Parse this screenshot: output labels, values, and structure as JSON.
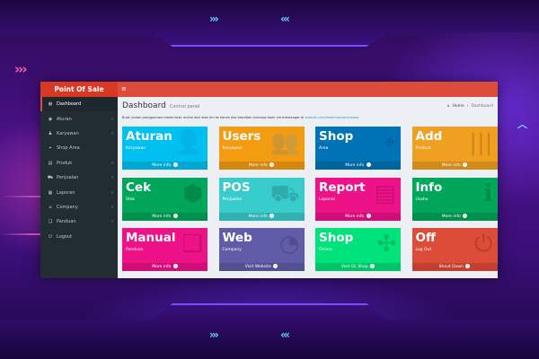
{
  "window": {
    "logo": "Point Of Sale",
    "menu_icon": "≡"
  },
  "sidebar": {
    "items": [
      {
        "label": "Dashboard",
        "icon": "◍",
        "arrow": ""
      },
      {
        "label": "Aturan",
        "icon": "◉",
        "arrow": "‹"
      },
      {
        "label": "Karyawan",
        "icon": "♟",
        "arrow": "‹"
      },
      {
        "label": "Shop Area",
        "icon": "⌖",
        "arrow": ""
      },
      {
        "label": "Produk",
        "icon": "▤",
        "arrow": "‹"
      },
      {
        "label": "Penjualan",
        "icon": "⛟",
        "arrow": "‹"
      },
      {
        "label": "Laporan",
        "icon": "▦",
        "arrow": "‹"
      },
      {
        "label": "Company",
        "icon": "⌂",
        "arrow": "‹"
      },
      {
        "label": "Panduan",
        "icon": "❏",
        "arrow": "‹"
      },
      {
        "label": "Logout",
        "icon": "⏻",
        "arrow": ""
      }
    ]
  },
  "header": {
    "title": "Dashboard",
    "subtitle": "Control panel"
  },
  "breadcrumb": {
    "home": "Home",
    "current": "Dashboard"
  },
  "description": {
    "text": "Buat urutan penggunaan mesin kasir online dari atas kiri ke kanan jika kesulitan hubungi kami via messenger di",
    "link": "www.fb.com/mesinkasironlinepos"
  },
  "tiles": [
    {
      "title": "Aturan",
      "sub": "Karyawan",
      "footer": "More info",
      "color": "#00c0ef",
      "icon": "👤"
    },
    {
      "title": "Users",
      "sub": "Karyawan",
      "footer": "More info",
      "color": "#f39c12",
      "icon": "👥"
    },
    {
      "title": "Shop",
      "sub": "Area",
      "footer": "More info",
      "color": "#0073b7",
      "icon": "⌖"
    },
    {
      "title": "Add",
      "sub": "Product",
      "footer": "More info",
      "color": "#f0a020",
      "icon": "|||"
    },
    {
      "title": "Cek",
      "sub": "Stok",
      "footer": "More info",
      "color": "#00a65a",
      "icon": "⬢"
    },
    {
      "title": "POS",
      "sub": "Penjualan",
      "footer": "More info",
      "color": "#39cccc",
      "icon": "⛟"
    },
    {
      "title": "Report",
      "sub": "Laporan",
      "footer": "More info",
      "color": "#ee1289",
      "icon": "▤"
    },
    {
      "title": "Info",
      "sub": "Usaha",
      "footer": "More info",
      "color": "#00a65a",
      "icon": "ℹ"
    },
    {
      "title": "Manual",
      "sub": "Panduan",
      "footer": "More info",
      "color": "#ee1289",
      "icon": "❏"
    },
    {
      "title": "Web",
      "sub": "Company",
      "footer": "Visit Website",
      "color": "#605ca8",
      "icon": "◔"
    },
    {
      "title": "Shop",
      "sub": "Online",
      "footer": "Visit OL Shop",
      "color": "#00e27a",
      "icon": "✣"
    },
    {
      "title": "Off",
      "sub": "Log Out",
      "footer": "Shout Down",
      "color": "#dd4b39",
      "icon": "⏻"
    }
  ],
  "deco": {
    "chev_right": "›››",
    "chev_left": "‹‹‹",
    "chev_up": "︿"
  }
}
